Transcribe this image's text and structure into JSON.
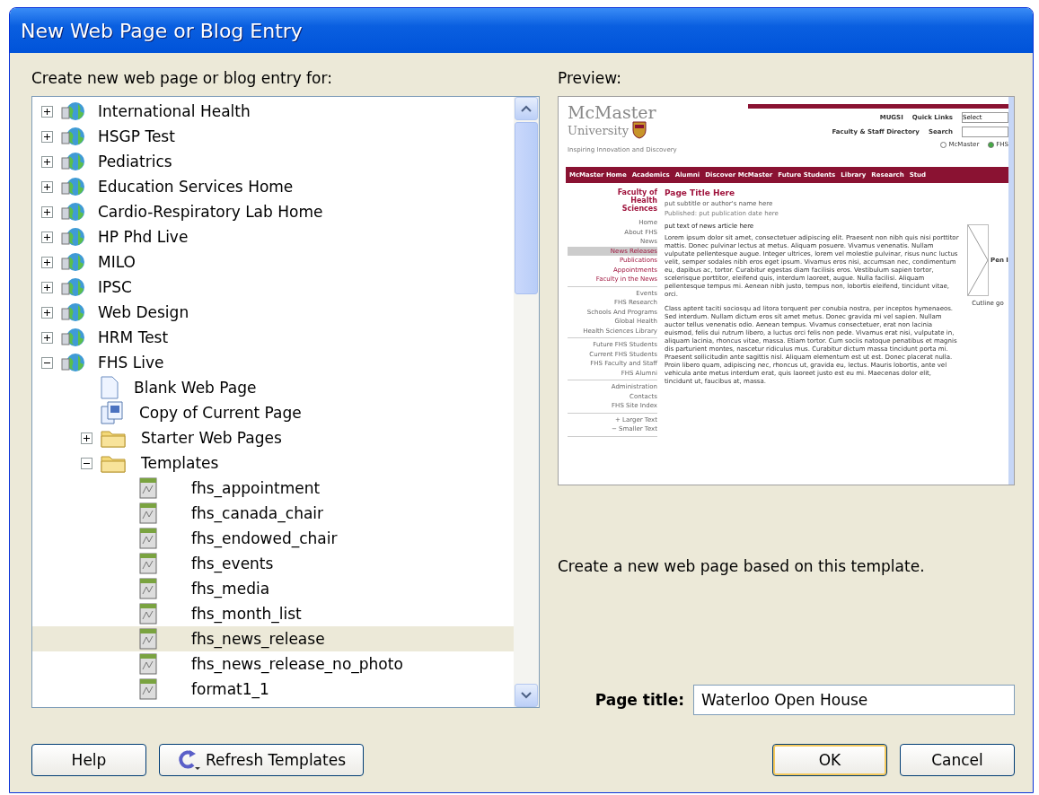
{
  "window": {
    "title": "New Web Page or Blog Entry"
  },
  "tree_label": "Create new web page or blog entry for:",
  "tree": [
    {
      "label": "International Health",
      "kind": "site",
      "expanded": false,
      "selected": false
    },
    {
      "label": "HSGP Test",
      "kind": "site",
      "expanded": false,
      "selected": false
    },
    {
      "label": "Pediatrics",
      "kind": "site",
      "expanded": false,
      "selected": false
    },
    {
      "label": "Education Services Home",
      "kind": "site",
      "expanded": false,
      "selected": false
    },
    {
      "label": "Cardio-Respiratory Lab Home",
      "kind": "site",
      "expanded": false,
      "selected": false
    },
    {
      "label": "HP Phd Live",
      "kind": "site",
      "expanded": false,
      "selected": false
    },
    {
      "label": "MILO",
      "kind": "site",
      "expanded": false,
      "selected": false
    },
    {
      "label": "IPSC",
      "kind": "site",
      "expanded": false,
      "selected": false
    },
    {
      "label": "Web Design",
      "kind": "site",
      "expanded": false,
      "selected": false
    },
    {
      "label": "HRM Test",
      "kind": "site",
      "expanded": false,
      "selected": false
    },
    {
      "label": "FHS Live",
      "kind": "site",
      "expanded": true,
      "selected": false,
      "children": [
        {
          "label": "Blank Web Page",
          "kind": "page",
          "selected": false
        },
        {
          "label": "Copy of Current Page",
          "kind": "copy",
          "selected": false
        },
        {
          "label": "Starter Web Pages",
          "kind": "folder",
          "expanded": false,
          "selected": false
        },
        {
          "label": "Templates",
          "kind": "folder",
          "expanded": true,
          "selected": false,
          "children": [
            {
              "label": "fhs_appointment",
              "kind": "template",
              "selected": false
            },
            {
              "label": "fhs_canada_chair",
              "kind": "template",
              "selected": false
            },
            {
              "label": "fhs_endowed_chair",
              "kind": "template",
              "selected": false
            },
            {
              "label": "fhs_events",
              "kind": "template",
              "selected": false
            },
            {
              "label": "fhs_media",
              "kind": "template",
              "selected": false
            },
            {
              "label": "fhs_month_list",
              "kind": "template",
              "selected": false
            },
            {
              "label": "fhs_news_release",
              "kind": "template",
              "selected": true
            },
            {
              "label": "fhs_news_release_no_photo",
              "kind": "template",
              "selected": false
            },
            {
              "label": "format1_1",
              "kind": "template",
              "selected": false
            }
          ]
        }
      ]
    }
  ],
  "preview": {
    "label": "Preview:",
    "page": {
      "logo_line1": "McMaster",
      "logo_line2": "University",
      "tagline": "Inspiring Innovation and Discovery",
      "header_links": [
        "MUGSI",
        "Faculty & Staff Directory"
      ],
      "quick_links_label": "Quick Links",
      "quick_links_value": "Select",
      "search_label": "Search",
      "search_scopes": [
        {
          "label": "McMaster",
          "selected": false
        },
        {
          "label": "FHS",
          "selected": true
        }
      ],
      "nav": [
        "McMaster Home",
        "Academics",
        "Alumni",
        "Discover McMaster",
        "Future Students",
        "Library",
        "Research",
        "Stud"
      ],
      "faculty": "Faculty of Health Sciences",
      "side_groups": [
        [
          {
            "label": "Home",
            "selected": false
          },
          {
            "label": "About FHS",
            "selected": false
          },
          {
            "label": "News",
            "selected": false
          },
          {
            "label": "News Releases",
            "selected": true
          },
          {
            "label": "Publications",
            "selected": false
          },
          {
            "label": "Appointments",
            "selected": false
          },
          {
            "label": "Faculty in the News",
            "selected": false
          }
        ],
        [
          {
            "label": "Events",
            "selected": false
          },
          {
            "label": "FHS Research",
            "selected": false
          },
          {
            "label": "Schools And Programs",
            "selected": false
          },
          {
            "label": "Global Health",
            "selected": false
          },
          {
            "label": "Health Sciences Library",
            "selected": false
          }
        ],
        [
          {
            "label": "Future FHS Students",
            "selected": false
          },
          {
            "label": "Current FHS Students",
            "selected": false
          },
          {
            "label": "FHS Faculty and Staff",
            "selected": false
          },
          {
            "label": "FHS Alumni",
            "selected": false
          }
        ],
        [
          {
            "label": "Administration",
            "selected": false
          },
          {
            "label": "Contacts",
            "selected": false
          },
          {
            "label": "FHS Site Index",
            "selected": false
          }
        ],
        [
          {
            "label": "+ Larger Text",
            "selected": false
          },
          {
            "label": "− Smaller Text",
            "selected": false
          }
        ]
      ],
      "title": "Page Title Here",
      "subtitle": "put subtitle or author's name here",
      "published": "Published: put publication date here",
      "lead": "put text of news article here",
      "paragraphs": [
        "Lorem ipsum dolor sit amet, consectetuer adipiscing elit. Praesent non nibh quis nisi porttitor mattis. Donec pulvinar lectus at metus. Aliquam posuere. Vivamus venenatis. Nullam vulputate pellentesque augue. Integer ultrices, lorem vel molestie pulvinar, risus nunc luctus velit, semper sodales nibh eros eget ipsum. Vivamus eros nisi, accumsan nec, condimentum eu, dapibus ac, tortor. Curabitur egestas diam facilisis eros. Vestibulum sapien tortor, scelerisque porttitor, eleifend quis, interdum laoreet, augue. Nulla facilisi. Aliquam pellentesque tempus mi. Aenean nibh justo, tempus non, lobortis eleifend, tincidunt vitae, orci.",
        "Class aptent taciti sociosqu ad litora torquent per conubia nostra, per inceptos hymenaeos. Sed interdum. Nullam dictum eros sit amet metus. Donec gravida mi vel sapien. Nullam auctor tellus venenatis odio. Aenean tempus. Vivamus consectetuer, erat non lacinia euismod, felis dui rutrum libero, a luctus orci felis non pede. Vivamus erat nisi, vulputate in, aliquam lacinia, rhoncus vitae, massa. Etiam tortor. Cum sociis natoque penatibus et magnis dis parturient montes, nascetur ridiculus mus. Curabitur dictum massa tincidunt porta mi. Praesent sollicitudin ante sagittis nisl. Aliquam elementum est ut est. Donec placerat nulla. Proin libero quam, adipiscing nec, rhoncus ut, gravida eu, lectus. Mauris lobortis, ante vel vehicula ante metus interdum erat, quis laoreet justo est eu mi. Maecenas dolor elit, tincidunt ut, faucibus at, massa."
      ],
      "photo_caption": "Cutline go",
      "photo_label": "Pen I"
    },
    "description": "Create a new web page based on this template."
  },
  "page_title": {
    "label": "Page title:",
    "value": "Waterloo Open House"
  },
  "buttons": [
    {
      "label": "Help",
      "kind": "plain",
      "focused": false
    },
    {
      "label": "Refresh Templates",
      "kind": "refresh",
      "focused": false
    },
    {
      "label": "OK",
      "kind": "plain",
      "focused": true
    },
    {
      "label": "Cancel",
      "kind": "plain",
      "focused": false
    }
  ]
}
